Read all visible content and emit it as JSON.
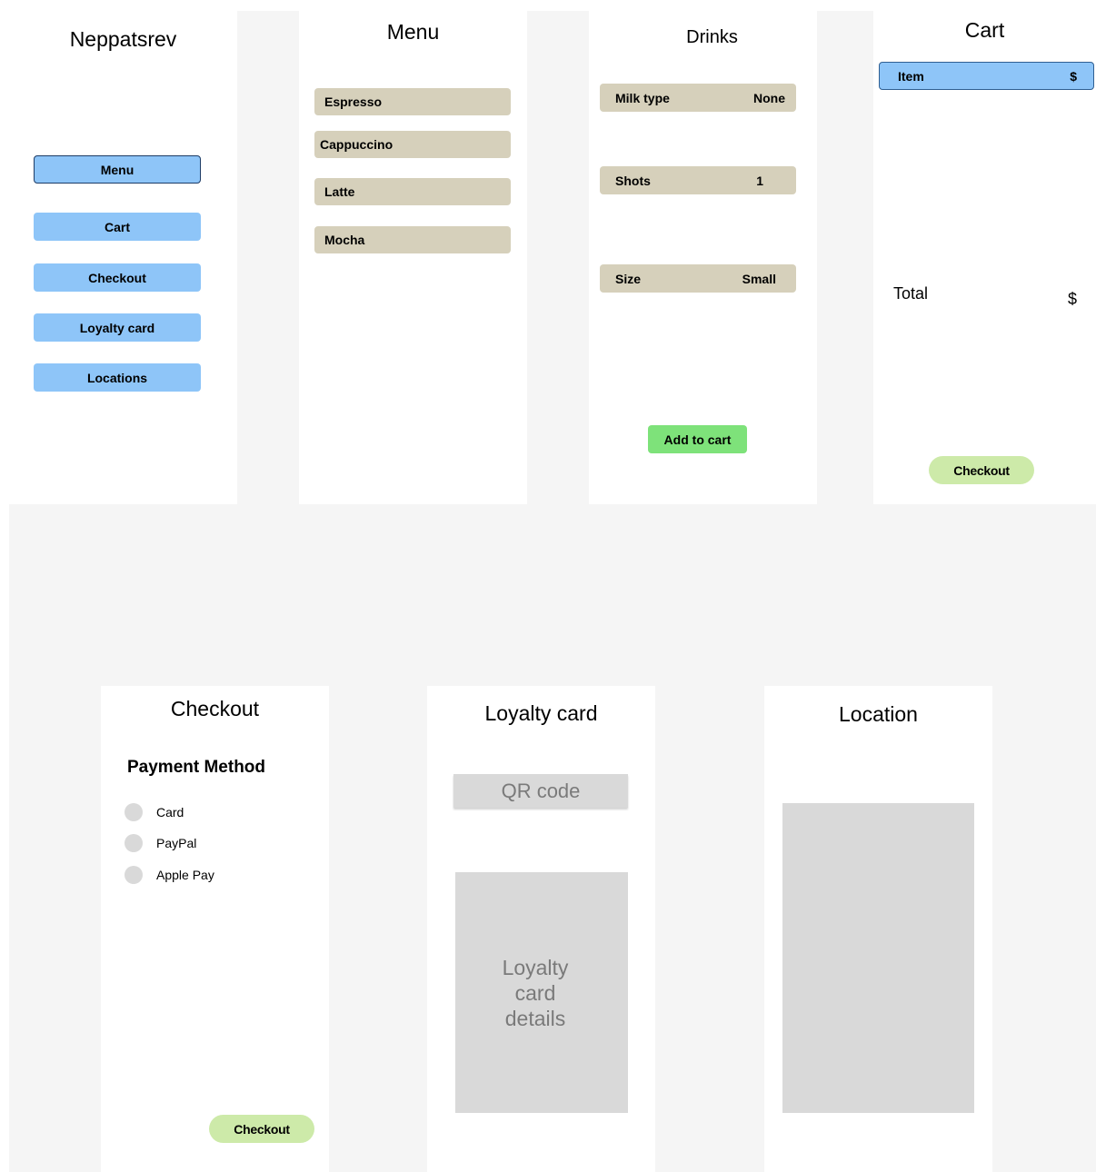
{
  "home": {
    "app_name": "Neppatsrev",
    "nav": [
      {
        "label": "Menu"
      },
      {
        "label": "Cart"
      },
      {
        "label": "Checkout"
      },
      {
        "label": "Loyalty card"
      },
      {
        "label": "Locations"
      }
    ]
  },
  "menu": {
    "title": "Menu",
    "items": [
      "Espresso",
      "Cappuccino",
      "Latte",
      "Mocha"
    ]
  },
  "drinks": {
    "title": "Drinks",
    "options": [
      {
        "label": "Milk type",
        "value": "None"
      },
      {
        "label": "Shots",
        "value": "1"
      },
      {
        "label": "Size",
        "value": "Small"
      }
    ],
    "add_to_cart_label": "Add to cart"
  },
  "cart": {
    "title": "Cart",
    "item_label": "Item",
    "item_price": "$",
    "total_label": "Total",
    "total_value": "$",
    "checkout_label": "Checkout"
  },
  "checkout": {
    "title": "Checkout",
    "payment_heading": "Payment Method",
    "payment_options": [
      "Card",
      "PayPal",
      "Apple Pay"
    ],
    "checkout_label": "Checkout"
  },
  "loyalty": {
    "title": "Loyalty card",
    "qr_label": "QR code",
    "details_label": "Loyalty card details"
  },
  "location": {
    "title": "Location"
  },
  "colors": {
    "nav_button": "#8ec5f8",
    "menu_item": "#d6d0bb",
    "add_to_cart": "#7ee27a",
    "checkout_button": "#cdeaa9",
    "placeholder": "#d9d9d9",
    "canvas": "#f5f5f5"
  }
}
